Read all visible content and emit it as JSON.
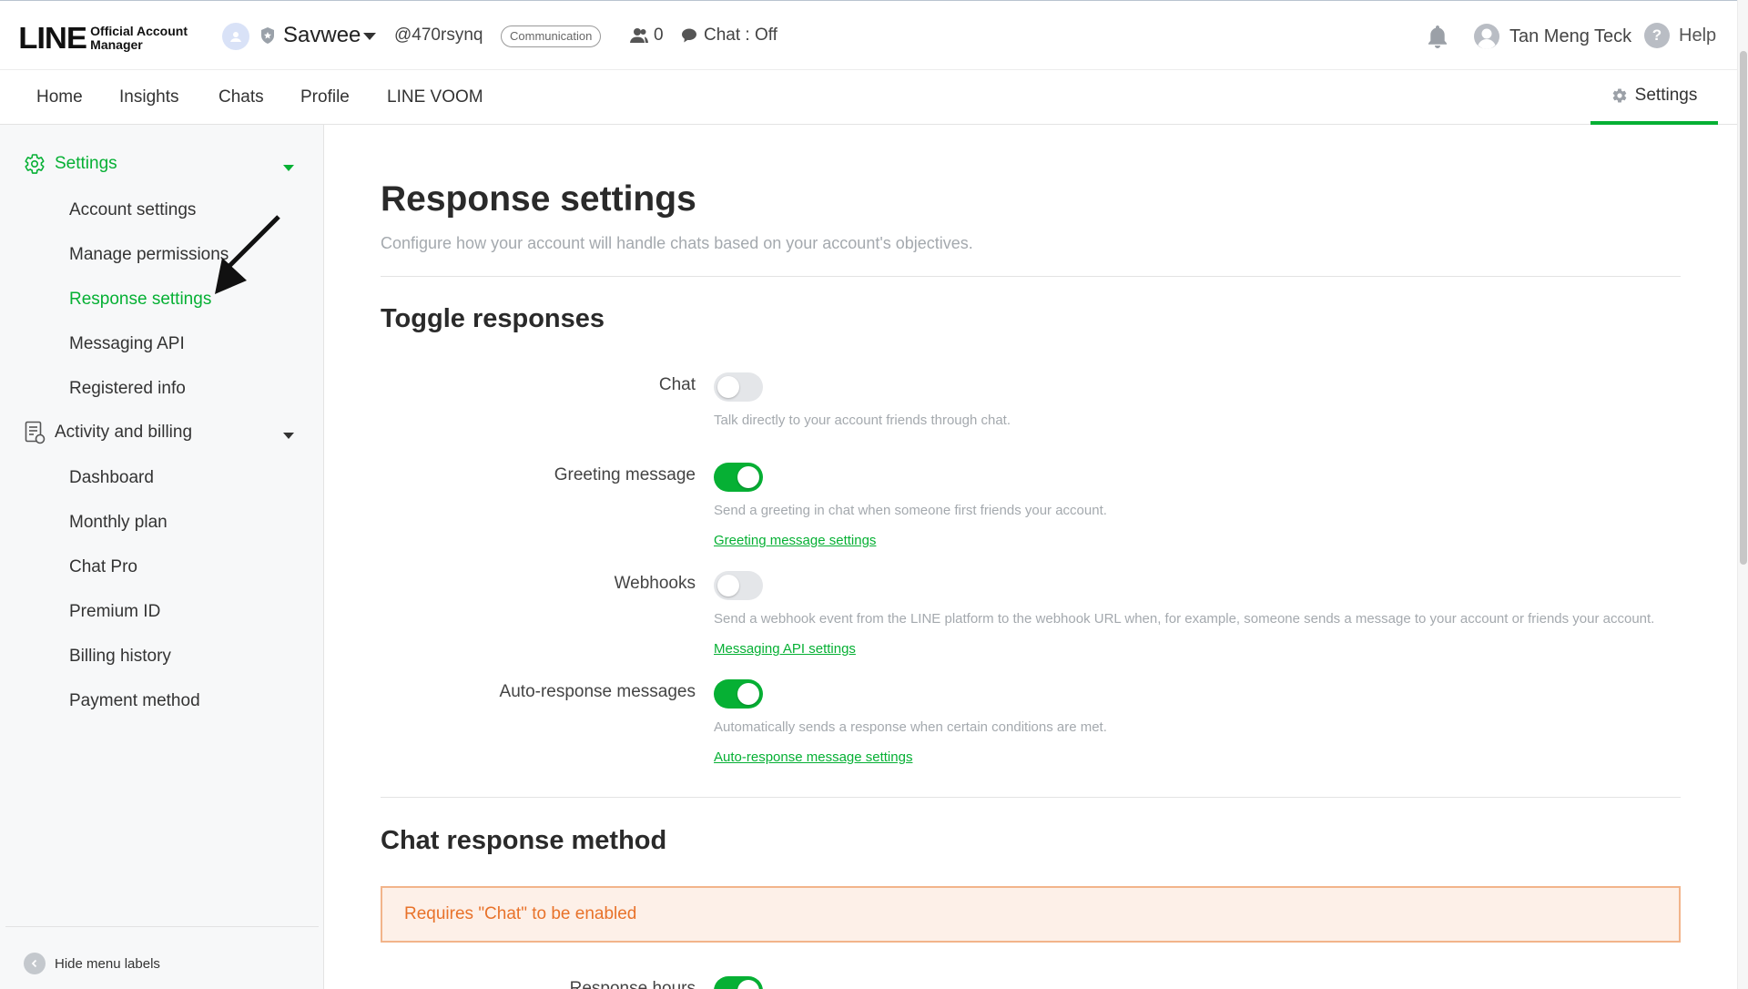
{
  "topbar": {
    "logo_main": "LINE",
    "logo_sub_1": "Official Account",
    "logo_sub_2": "Manager",
    "account_name": "Savwee",
    "account_id": "@470rsynq",
    "category": "Communication",
    "friends_count": "0",
    "chat_status": "Chat : Off",
    "user_name": "Tan Meng Teck",
    "help_label": "Help"
  },
  "nav": {
    "items": [
      "Home",
      "Insights",
      "Chats",
      "Profile",
      "LINE VOOM"
    ],
    "settings_label": "Settings"
  },
  "sidebar": {
    "settings_section": "Settings",
    "settings_items": [
      "Account settings",
      "Manage permissions",
      "Response settings",
      "Messaging API",
      "Registered info"
    ],
    "activity_section": "Activity and billing",
    "activity_items": [
      "Dashboard",
      "Monthly plan",
      "Chat Pro",
      "Premium ID",
      "Billing history",
      "Payment method"
    ],
    "hide_menu_label": "Hide menu labels",
    "active_item": "Response settings"
  },
  "main": {
    "title": "Response settings",
    "description": "Configure how your account will handle chats based on your account's objectives.",
    "toggle_section_title": "Toggle responses",
    "toggles": [
      {
        "label": "Chat",
        "on": false,
        "description": "Talk directly to your account friends through chat.",
        "link": ""
      },
      {
        "label": "Greeting message",
        "on": true,
        "description": "Send a greeting in chat when someone first friends your account.",
        "link": "Greeting message settings"
      },
      {
        "label": "Webhooks",
        "on": false,
        "description": "Send a webhook event from the LINE platform to the webhook URL when, for example, someone sends a message to your account or friends your account.",
        "link": "Messaging API settings"
      },
      {
        "label": "Auto-response messages",
        "on": true,
        "description": "Automatically sends a response when certain conditions are met.",
        "link": "Auto-response message settings"
      }
    ],
    "chat_method_title": "Chat response method",
    "warning": "Requires \"Chat\" to be enabled",
    "response_hours_label": "Response hours",
    "response_hours_on": true
  },
  "colors": {
    "accent": "#06b034",
    "warning_text": "#e8722a",
    "warning_bg": "#fdf0e8",
    "warning_border": "#f2b48a"
  }
}
